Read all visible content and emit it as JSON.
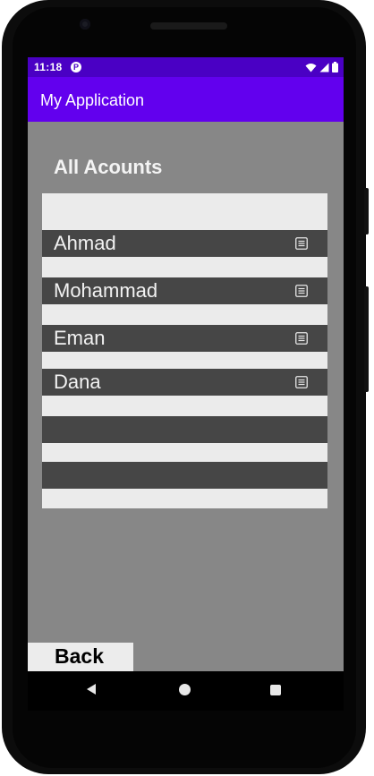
{
  "status_bar": {
    "time": "11:18",
    "app_icon_letter": "P",
    "icons": [
      "wifi-icon",
      "signal-icon",
      "battery-icon"
    ]
  },
  "app_bar": {
    "title": "My Application"
  },
  "main": {
    "heading": "All Acounts",
    "accounts": [
      {
        "name": "Ahmad",
        "icon": "details-icon"
      },
      {
        "name": "Mohammad",
        "icon": "details-icon"
      },
      {
        "name": "Eman",
        "icon": "details-icon"
      },
      {
        "name": "Dana",
        "icon": "details-icon"
      },
      {
        "name": "",
        "icon": ""
      },
      {
        "name": "",
        "icon": ""
      }
    ],
    "back_label": "Back"
  },
  "nav_bar": {
    "buttons": [
      "back",
      "home",
      "recents"
    ]
  },
  "colors": {
    "status_bar": "#4a00c4",
    "app_bar": "#6200ee",
    "screen_background": "#878787",
    "row_background": "#464646",
    "list_background": "#ebebeb"
  }
}
